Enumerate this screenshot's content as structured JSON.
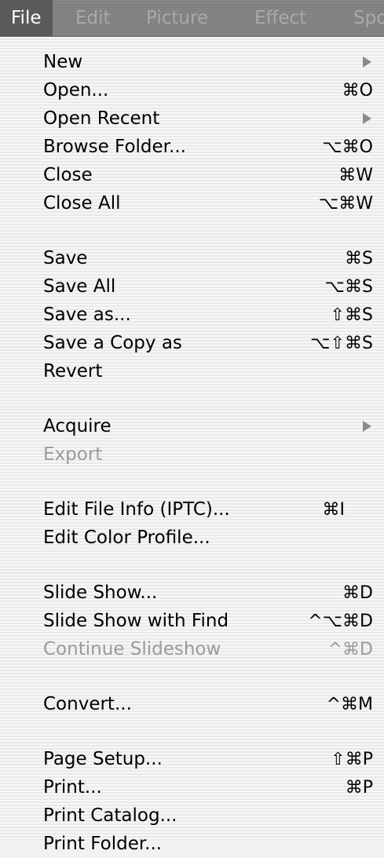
{
  "menubar": {
    "menus": [
      "File",
      "Edit",
      "Picture",
      "Effect",
      "Spo"
    ]
  },
  "file_menu": {
    "items": [
      {
        "label": "New",
        "submenu": true
      },
      {
        "label": "Open...",
        "shortcut": "⌘O"
      },
      {
        "label": "Open Recent",
        "submenu": true
      },
      {
        "label": "Browse Folder...",
        "shortcut": "⌥⌘O"
      },
      {
        "label": "Close",
        "shortcut": "⌘W"
      },
      {
        "label": "Close All",
        "shortcut": "⌥⌘W"
      },
      {
        "label": "Save",
        "shortcut": "⌘S"
      },
      {
        "label": "Save All",
        "shortcut": "⌥⌘S"
      },
      {
        "label": "Save as...",
        "shortcut": "⇧⌘S"
      },
      {
        "label": "Save a Copy as",
        "shortcut": "⌥⇧⌘S"
      },
      {
        "label": "Revert"
      },
      {
        "label": "Acquire",
        "submenu": true
      },
      {
        "label": "Export",
        "disabled": true
      },
      {
        "label": "Edit File Info (IPTC)...",
        "shortcut": "⌘I"
      },
      {
        "label": "Edit Color Profile..."
      },
      {
        "label": "Slide Show...",
        "shortcut": "⌘D"
      },
      {
        "label": "Slide Show with Find",
        "shortcut": "^⌥⌘D"
      },
      {
        "label": "Continue Slideshow",
        "shortcut": "^⌘D",
        "disabled": true
      },
      {
        "label": "Convert...",
        "shortcut": "^⌘M"
      },
      {
        "label": "Page Setup...",
        "shortcut": "⇧⌘P"
      },
      {
        "label": "Print...",
        "shortcut": "⌘P"
      },
      {
        "label": "Print Catalog..."
      },
      {
        "label": "Print Folder..."
      }
    ]
  },
  "colors": {
    "menubar_bg": "#7b7b7b",
    "menu_title_active_bg": "#5a5a5a",
    "menu_title_inactive": "#a9a9a9",
    "dropdown_bg": "#f2f2f2",
    "disabled_text": "#9a9a9a",
    "submenu_arrow": "#8a8a8a"
  }
}
